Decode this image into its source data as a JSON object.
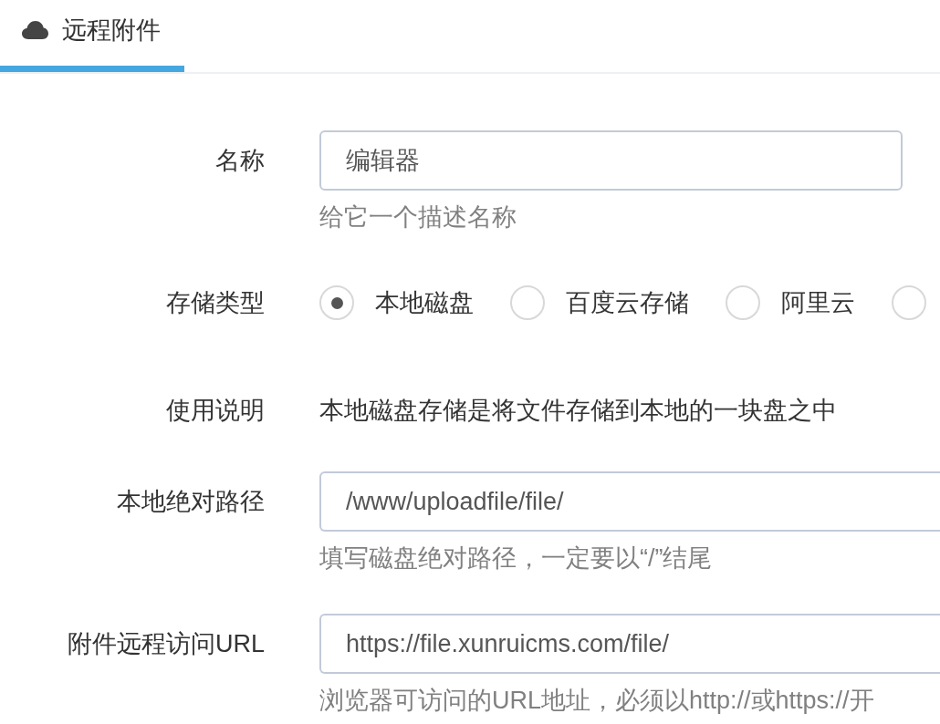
{
  "tabs": [
    {
      "label": "远程附件",
      "selected": true
    }
  ],
  "form": {
    "rows": [
      {
        "kind": "input",
        "label": "名称",
        "value": "编辑器",
        "help": "给它一个描述名称"
      },
      {
        "kind": "radio",
        "label": "存储类型",
        "options": [
          {
            "label": "本地磁盘",
            "selected": true
          },
          {
            "label": "百度云存储",
            "selected": false
          },
          {
            "label": "阿里云",
            "selected": false
          },
          {
            "selected": false
          }
        ]
      },
      {
        "kind": "text",
        "label": "使用说明",
        "text": "本地磁盘存储是将文件存储到本地的一块盘之中"
      },
      {
        "kind": "input",
        "label": "本地绝对路径",
        "value": "/www/uploadfile/file/",
        "help": "填写磁盘绝对路径，一定要以“/”结尾"
      },
      {
        "kind": "input",
        "label": "附件远程访问URL",
        "value": "https://file.xunruicms.com/file/",
        "help": "浏览器可访问的URL地址，必须以http://或https://开"
      }
    ]
  }
}
